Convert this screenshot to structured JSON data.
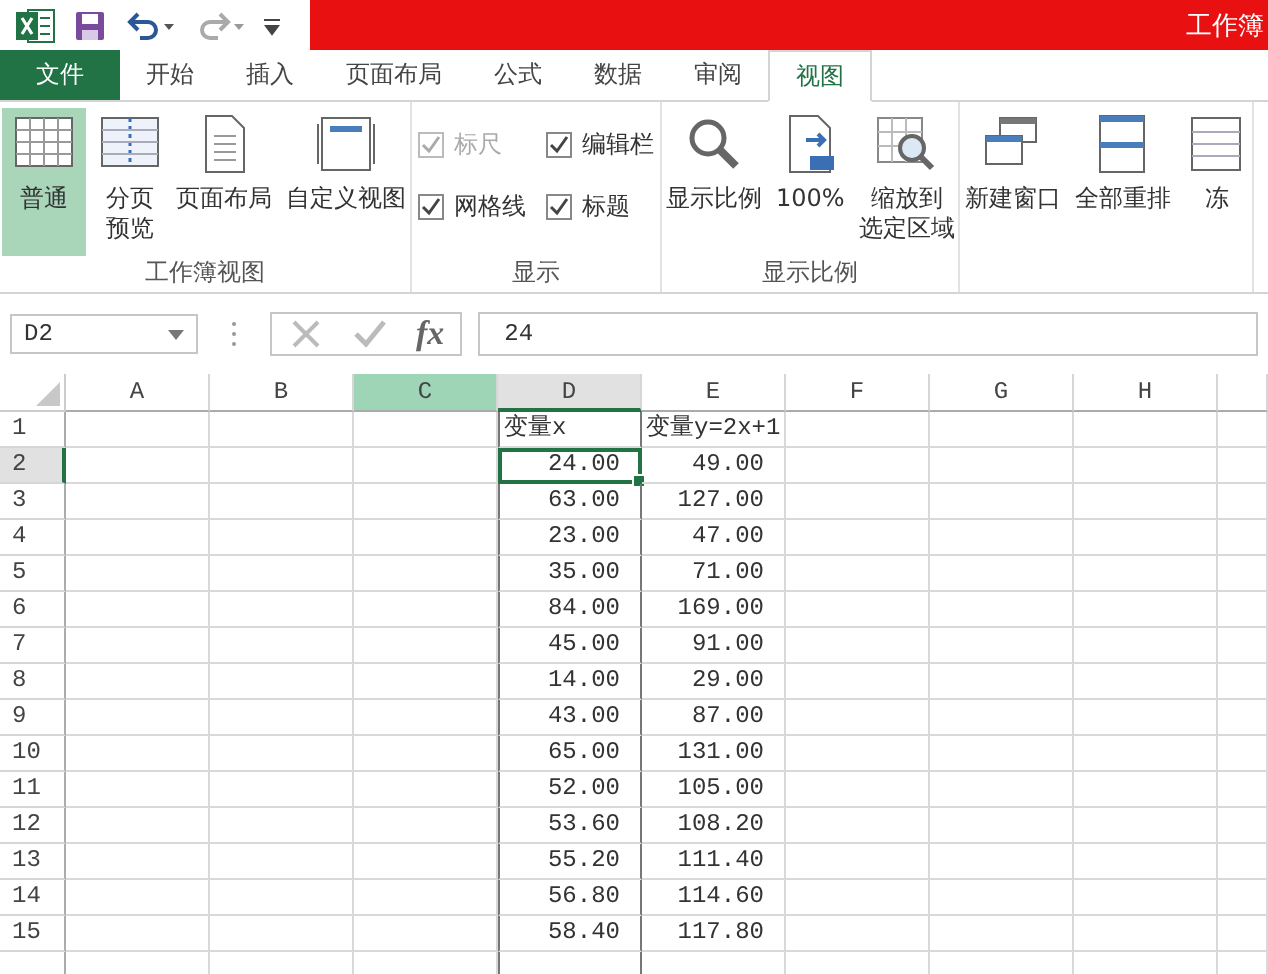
{
  "quick_access": {
    "undo_enabled": true,
    "redo_enabled": false
  },
  "window": {
    "title": "工作簿"
  },
  "tabs": [
    {
      "label": "文件",
      "kind": "file",
      "selected": false
    },
    {
      "label": "开始",
      "kind": "tab",
      "selected": false
    },
    {
      "label": "插入",
      "kind": "tab",
      "selected": false
    },
    {
      "label": "页面布局",
      "kind": "tab",
      "selected": false
    },
    {
      "label": "公式",
      "kind": "tab",
      "selected": false
    },
    {
      "label": "数据",
      "kind": "tab",
      "selected": false
    },
    {
      "label": "审阅",
      "kind": "tab",
      "selected": false
    },
    {
      "label": "视图",
      "kind": "tab",
      "selected": true
    }
  ],
  "ribbon_groups": [
    {
      "label": "工作簿视图",
      "kind": "buttons",
      "items": [
        {
          "lines": [
            "普通"
          ],
          "selected": true
        },
        {
          "lines": [
            "分页",
            "预览"
          ],
          "selected": false
        },
        {
          "lines": [
            "页面布局"
          ],
          "selected": false
        },
        {
          "lines": [
            "自定义视图"
          ],
          "selected": false
        }
      ]
    },
    {
      "label": "显示",
      "kind": "checks",
      "items": [
        {
          "label": "标尺",
          "checked": true,
          "disabled": true
        },
        {
          "label": "编辑栏",
          "checked": true,
          "disabled": false
        },
        {
          "label": "网格线",
          "checked": true,
          "disabled": false
        },
        {
          "label": "标题",
          "checked": true,
          "disabled": false
        }
      ]
    },
    {
      "label": "显示比例",
      "kind": "buttons",
      "items": [
        {
          "lines": [
            "显示比例"
          ],
          "selected": false
        },
        {
          "lines": [
            "100%"
          ],
          "selected": false
        },
        {
          "lines": [
            "缩放到",
            "选定区域"
          ],
          "selected": false
        }
      ]
    },
    {
      "kind": "buttons",
      "items": [
        {
          "lines": [
            "新建窗口"
          ],
          "selected": false
        },
        {
          "lines": [
            "全部重排"
          ],
          "selected": false
        },
        {
          "lines": [
            "冻"
          ],
          "selected": false
        }
      ]
    }
  ],
  "formula_bar": {
    "name_box": "D2",
    "function_button": "fx",
    "value": "24"
  },
  "columns": [
    {
      "label": "A",
      "selected": false,
      "active": false
    },
    {
      "label": "B",
      "selected": false,
      "active": false
    },
    {
      "label": "C",
      "selected": true,
      "active": false
    },
    {
      "label": "D",
      "selected": false,
      "active": true
    },
    {
      "label": "E",
      "selected": false,
      "active": false
    },
    {
      "label": "F",
      "selected": false,
      "active": false
    },
    {
      "label": "G",
      "selected": false,
      "active": false
    },
    {
      "label": "H",
      "selected": false,
      "active": false
    }
  ],
  "rows": [
    {
      "number": "1",
      "active": false,
      "cells": {
        "D": "变量x",
        "E": "变量y=2x+1"
      }
    },
    {
      "number": "2",
      "active": true,
      "cells": {
        "D": "24.00",
        "E": "49.00"
      }
    },
    {
      "number": "3",
      "active": false,
      "cells": {
        "D": "63.00",
        "E": "127.00"
      }
    },
    {
      "number": "4",
      "active": false,
      "cells": {
        "D": "23.00",
        "E": "47.00"
      }
    },
    {
      "number": "5",
      "active": false,
      "cells": {
        "D": "35.00",
        "E": "71.00"
      }
    },
    {
      "number": "6",
      "active": false,
      "cells": {
        "D": "84.00",
        "E": "169.00"
      }
    },
    {
      "number": "7",
      "active": false,
      "cells": {
        "D": "45.00",
        "E": "91.00"
      }
    },
    {
      "number": "8",
      "active": false,
      "cells": {
        "D": "14.00",
        "E": "29.00"
      }
    },
    {
      "number": "9",
      "active": false,
      "cells": {
        "D": "43.00",
        "E": "87.00"
      }
    },
    {
      "number": "10",
      "active": false,
      "cells": {
        "D": "65.00",
        "E": "131.00"
      }
    },
    {
      "number": "11",
      "active": false,
      "cells": {
        "D": "52.00",
        "E": "105.00"
      }
    },
    {
      "number": "12",
      "active": false,
      "cells": {
        "D": "53.60",
        "E": "108.20"
      }
    },
    {
      "number": "13",
      "active": false,
      "cells": {
        "D": "55.20",
        "E": "111.40"
      }
    },
    {
      "number": "14",
      "active": false,
      "cells": {
        "D": "56.80",
        "E": "114.60"
      }
    },
    {
      "number": "15",
      "active": false,
      "cells": {
        "D": "58.40",
        "E": "117.80"
      }
    }
  ]
}
